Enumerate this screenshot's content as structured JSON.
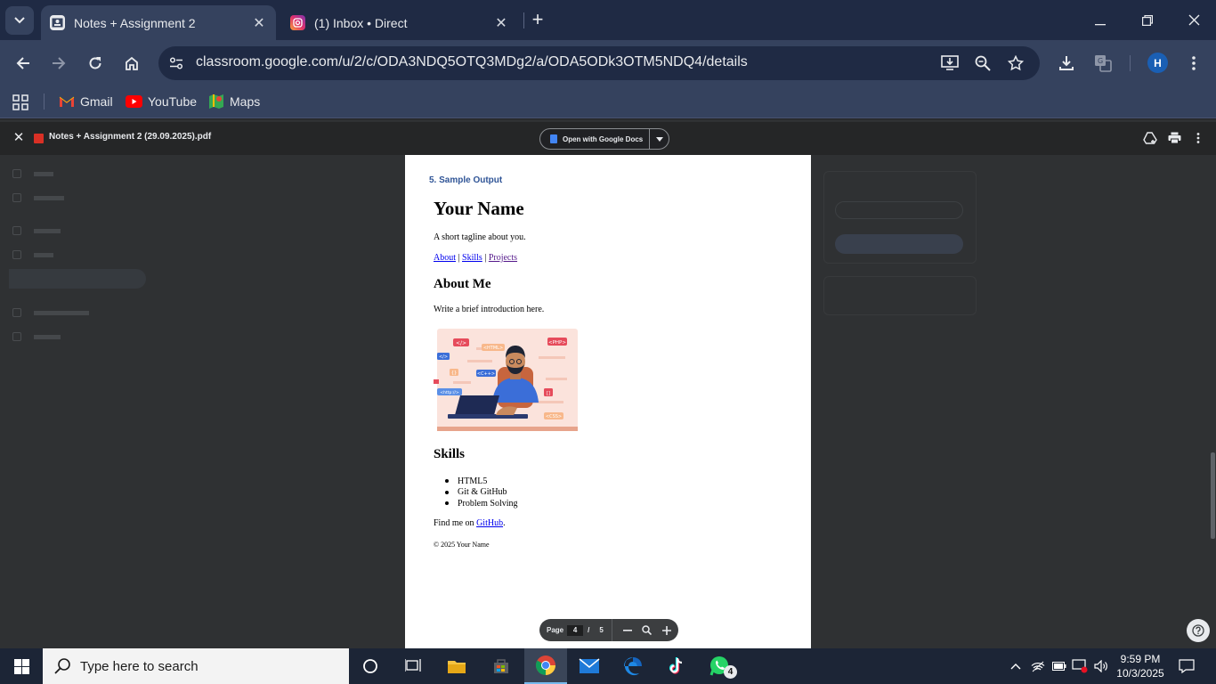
{
  "browser": {
    "tabs": [
      {
        "title": "Notes + Assignment 2",
        "favicon": "classroom-icon",
        "active": true
      },
      {
        "title": "(1) Inbox • Direct",
        "favicon": "instagram-icon",
        "active": false
      }
    ],
    "url": "classroom.google.com/u/2/c/ODA3NDQ5OTQ3MDg2/a/ODA5ODk3OTM5NDQ4/details",
    "profile_initial": "H",
    "bookmarks": [
      "Gmail",
      "YouTube",
      "Maps"
    ]
  },
  "pdf_viewer": {
    "filename": "Notes + Assignment 2 (29.09.2025).pdf",
    "open_with_label": "Open with Google Docs",
    "page_label": "Page",
    "current_page": "4",
    "page_sep": "/",
    "total_pages": "5"
  },
  "pdf_page": {
    "section_title": "5. Sample Output",
    "heading": "Your Name",
    "tagline": "A short tagline about you.",
    "nav_links": [
      "About",
      "Skills",
      "Projects"
    ],
    "nav_sep": "|",
    "about_heading": "About Me",
    "about_text": "Write a brief introduction here.",
    "illustration_tags": [
      "</>",
      "<HTML>",
      "<PHP>",
      "</>",
      "<C++>",
      "<http://>",
      "{}",
      "[]",
      "<CSS>"
    ],
    "skills_heading": "Skills",
    "skills": [
      "HTML5",
      "Git & GitHub",
      "Problem Solving"
    ],
    "find_me_prefix": "Find me on",
    "find_me_link": "GitHub",
    "find_me_suffix": ".",
    "footer": "© 2025 Your Name"
  },
  "taskbar": {
    "search_placeholder": "Type here to search",
    "time": "9:59 PM",
    "date": "10/3/2025",
    "whatsapp_badge": "4"
  },
  "colors": {
    "tab_strip": "#1f2a44",
    "toolbar": "#35425e",
    "pdf_section_title": "#2f5496",
    "link": "#0000ee",
    "visited_link": "#551a8b"
  }
}
